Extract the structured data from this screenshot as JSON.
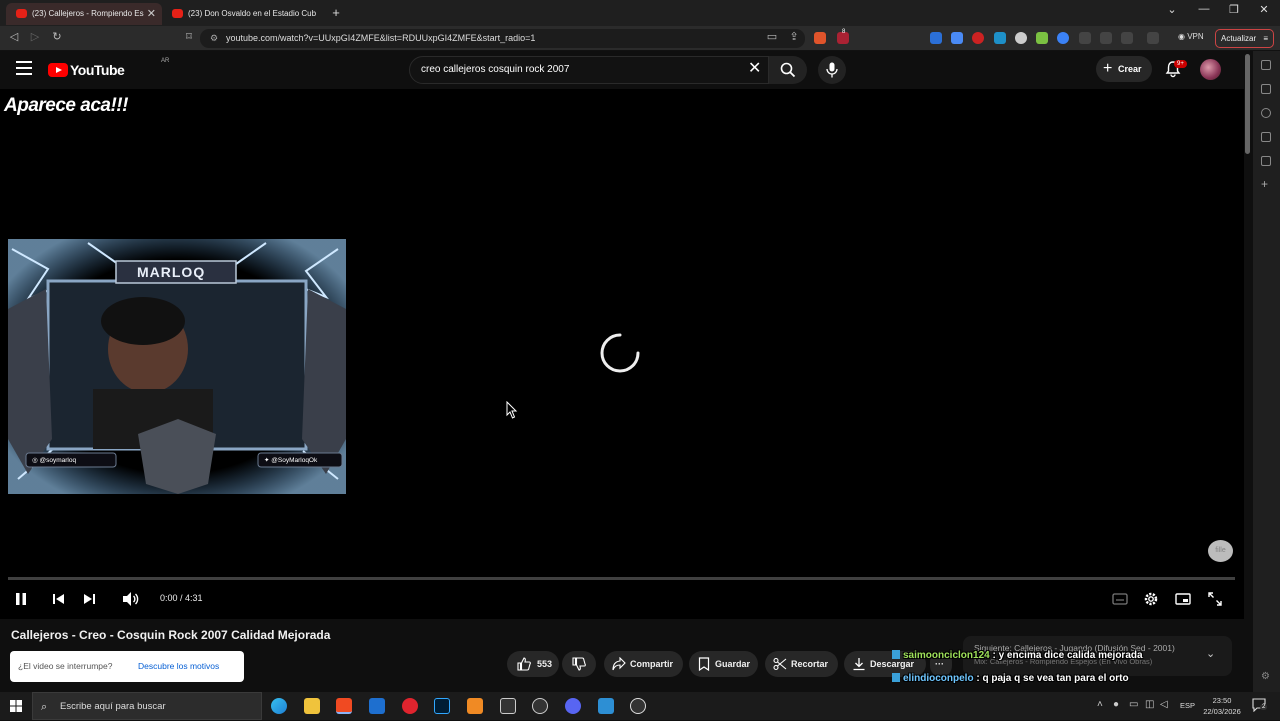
{
  "browser": {
    "tabs": [
      {
        "title": "(23) Callejeros - Rompiendo Es"
      },
      {
        "title": "(23) Don Osvaldo en el Estadio Cub"
      }
    ],
    "url": "youtube.com/watch?v=UUxpGI4ZMFE&list=RDUUxpGI4ZMFE&start_radio=1",
    "vpn_label": "VPN",
    "update_label": "Actualizar",
    "extension_badge": "8"
  },
  "youtube": {
    "logo_text": "YouTube",
    "country_code": "AR",
    "search_query": "creo callejeros cosquin rock 2007",
    "create_label": "Crear",
    "notification_count": "9+"
  },
  "video": {
    "overlay_text": "Aparece aca!!!",
    "webcam": {
      "name_banner": "MARLOQ",
      "instagram": "@soymarloq",
      "twitter": "@SoyMarloqOk"
    },
    "time": "0:00 / 4:31",
    "watermark": "fille",
    "title": "Callejeros - Creo - Cosquin Rock 2007 Calidad Mejorada"
  },
  "interrupt": {
    "question": "¿El video se interrumpe?",
    "link": "Descubre los motivos"
  },
  "actions": {
    "likes": "553",
    "share": "Compartir",
    "save": "Guardar",
    "clip": "Recortar",
    "download": "Descargar"
  },
  "next_up": {
    "label": "Siguiente: Callejeros - Jugando (Difusión Sed - 2001)",
    "sub": "Mix: Callejeros - Rompiendo Espejos (En Vivo Obras)"
  },
  "chat": [
    {
      "user": "saimoonciclon124",
      "message": " : y encima dice calida mejorada",
      "user_color": "#9fe25a"
    },
    {
      "user": "elindioconpelo",
      "message": " : q paja q se vea tan para el orto",
      "user_color": "#6ec6ff"
    }
  ],
  "taskbar": {
    "search_placeholder": "Escribe aquí para buscar",
    "language": "ESP",
    "time": "23:50",
    "date": "22/03/2026",
    "notification_count": "2"
  },
  "colors": {
    "youtube_red": "#ff0000",
    "link_blue": "#065fd4",
    "background": "#0f0f0f"
  }
}
